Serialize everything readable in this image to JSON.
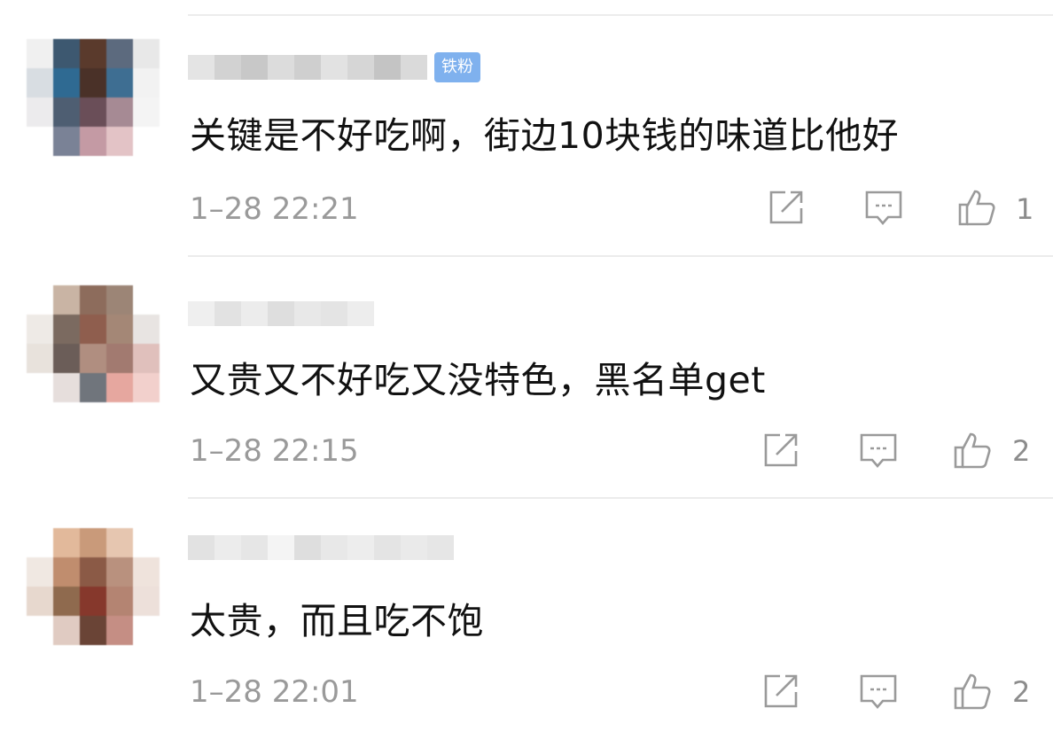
{
  "comments": [
    {
      "badge": "铁粉",
      "text": "关键是不好吃啊，街边10块钱的味道比他好",
      "time": "1–28 22:21",
      "like_count": "1",
      "icons": [
        "share-icon",
        "comment-icon",
        "like-icon"
      ]
    },
    {
      "text": "又贵又不好吃又没特色，黑名单get",
      "time": "1–28 22:15",
      "like_count": "2",
      "icons": [
        "share-icon",
        "comment-icon",
        "like-icon"
      ]
    },
    {
      "text": "太贵，而且吃不饱",
      "time": "1–28 22:01",
      "like_count": "2",
      "icons": [
        "share-icon",
        "comment-icon",
        "like-icon"
      ]
    }
  ],
  "colors": {
    "badge_bg": "#7fb1ee",
    "time_text": "#9a9a9a",
    "icon_stroke": "#9a9a9a",
    "divider": "#ececec"
  }
}
